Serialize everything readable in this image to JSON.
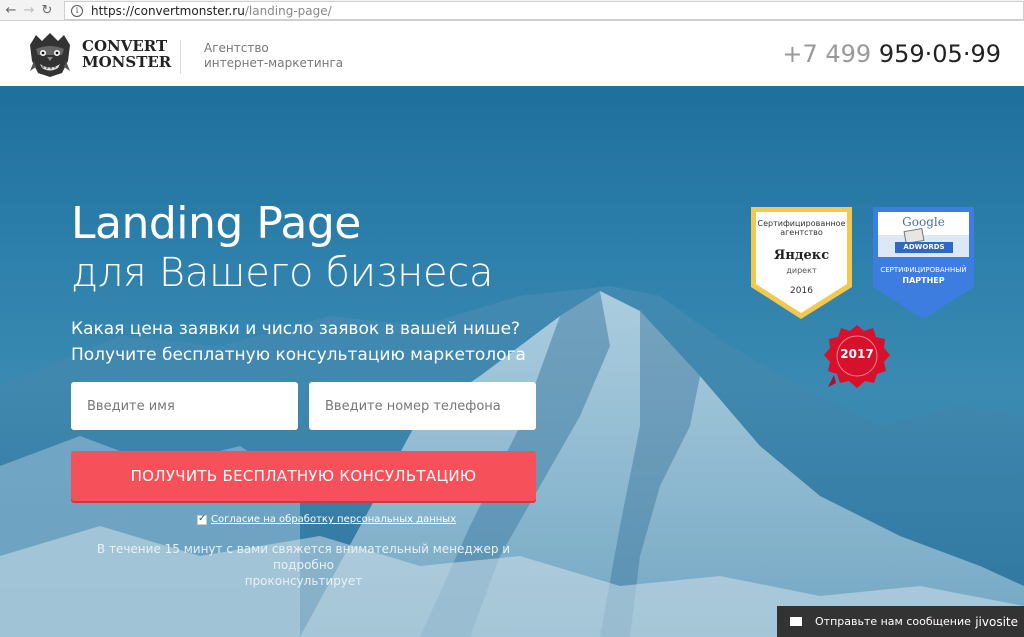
{
  "browser": {
    "url_base": "https://convertmonster.ru",
    "url_path": "/landing-page/",
    "back_icon": "back-arrow-icon",
    "forward_icon": "forward-arrow-icon",
    "reload_icon": "reload-icon",
    "info_icon": "info-icon",
    "info_glyph": "i"
  },
  "header": {
    "logo_line1": "CONVERT",
    "logo_line2": "MONSTER",
    "tagline_line1": "Агентство",
    "tagline_line2": "интернет-маркетинга",
    "phone_prefix": "+7 499",
    "phone_number": "959·05·99"
  },
  "hero": {
    "title_line1": "Landing Page",
    "title_line2": "для Вашего бизнеса",
    "subtitle_line1": "Какая цена заявки и число заявок в вашей нише?",
    "subtitle_line2": "Получите бесплатную консультацию маркетолога",
    "name_placeholder": "Введите имя",
    "phone_placeholder": "Введите номер телефона",
    "cta_label": "ПОЛУЧИТЬ БЕСПЛАТНУЮ КОНСУЛЬТАЦИЮ",
    "consent_label": "Согласие на обработку персональных данных",
    "consent_checked": true,
    "note_line1": "В течение 15 минут с вами свяжется внимательный менеджер и подробно",
    "note_line2": "проконсультирует"
  },
  "badges": {
    "yandex": {
      "top_line1": "Сертифицированное",
      "top_line2": "агентство",
      "brand": "Яндекс",
      "sub": "директ",
      "year": "2016"
    },
    "google": {
      "brand": "Google",
      "adwords": "ADWORDS",
      "cert": "СЕРТИФИЦИРОВАННЫЙ",
      "partner": "ПАРТНЕР"
    },
    "seal_year": "2017"
  },
  "chat": {
    "label": "Отправьте нам сообщение",
    "brand": "jivosite",
    "icon": "envelope-icon"
  },
  "colors": {
    "hero_blue": "#2d80ab",
    "cta_red": "#f6505a",
    "badge_gold": "#f2c94c",
    "badge_google_blue": "#3d7de0",
    "seal_red": "#d7102c",
    "chat_bg": "#333333"
  }
}
